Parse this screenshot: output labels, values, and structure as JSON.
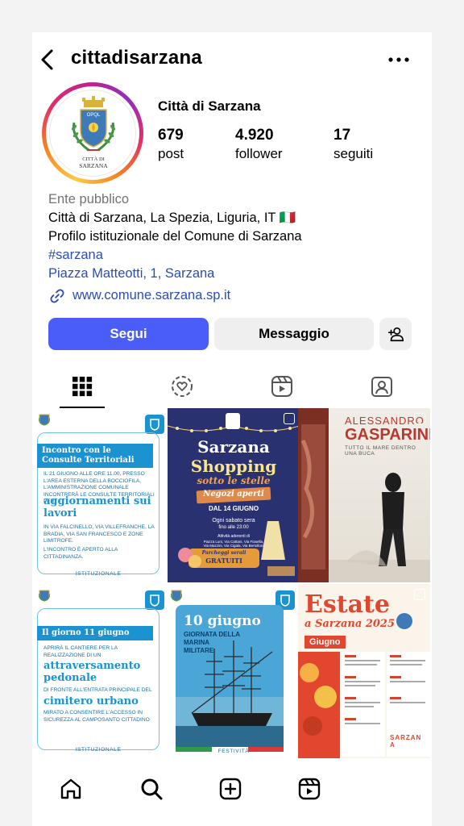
{
  "header": {
    "username": "cittadisarzana",
    "back_icon": "chevron-left-icon",
    "more_icon": "more-horizontal-icon"
  },
  "profile": {
    "display_name": "Città di Sarzana",
    "avatar_text_top": "OPQL",
    "avatar_text_bottom_1": "CITTÀ DI",
    "avatar_text_bottom_2": "SARZANA",
    "stats": [
      {
        "value": "679",
        "label": "post"
      },
      {
        "value": "4.920",
        "label": "follower"
      },
      {
        "value": "17",
        "label": "seguiti"
      }
    ]
  },
  "bio": {
    "category": "Ente pubblico",
    "line1": "Città di Sarzana, La Spezia, Liguria, IT",
    "flag": "🇮🇹",
    "line2": "Profilo istituzionale del Comune di Sarzana",
    "hashtag": "#sarzana",
    "address": "Piazza Matteotti, 1, Sarzana",
    "website": "www.comune.sarzana.sp.it"
  },
  "actions": {
    "follow": "Segui",
    "message": "Messaggio"
  },
  "tabs": [
    "grid-icon",
    "reels-ring-icon",
    "reels-icon",
    "tagged-icon"
  ],
  "posts": {
    "p1": {
      "ribbon": "Incontro con le Consulte Territoriali",
      "body": "Il 21 giugno alle ore 11.00, presso l'area esterna della Bocciofila, l'Amministrazione Comunale incontrerà le Consulte Territoriali per",
      "big": "aggiornamenti sui lavori",
      "body2": "in via Falcinello, via Villefranche, la Bradia, via San Francesco e zone limitrofe.",
      "body3": "L'incontro è aperto alla cittadinanza.",
      "footer": "ISTITUZIONALE"
    },
    "p2": {
      "title1": "Sarzana",
      "title2": "Shopping",
      "subtitle": "sotto le stelle",
      "sign": "Negozi aperti",
      "date": "DAL 14 GIUGNO",
      "note1": "Ogni sabato sera",
      "note2": "fino alle 23:00",
      "note3": "Attività aderenti di",
      "note4": "Piazza Luni, Via Cattani, Via Fiasella, Via Mazzini, Via Cigala, Via Bertolloni",
      "badge1": "Parcheggi serali",
      "badge2": "GRATUITI"
    },
    "p3": {
      "line1": "ALESSANDRO",
      "line2": "GASPARINI",
      "line3": "TUTTO IL MARE DENTRO UNA BUCA"
    },
    "p4": {
      "ribbon": "Il giorno 11 giugno",
      "body": "Aprirà il cantiere per la realizzazione di un",
      "big": "attraversamento pedonale",
      "body2": "di fronte all'entrata principale del",
      "big2": "cimitero urbano",
      "body3": "mirato a consentire l'accesso in sicurezza al camposanto cittadino",
      "footer": "ISTITUZIONALE"
    },
    "p5": {
      "date": "10 giugno",
      "title": "GIORNATA DELLA MARINA MILITARE",
      "footer": "FESTIVITÀ"
    },
    "p6": {
      "title": "Estate",
      "subtitle": "a Sarzana 2025",
      "month": "Giugno",
      "logo": "SARZANA"
    }
  },
  "nav": [
    "home-icon",
    "search-icon",
    "create-icon",
    "reels-icon"
  ]
}
